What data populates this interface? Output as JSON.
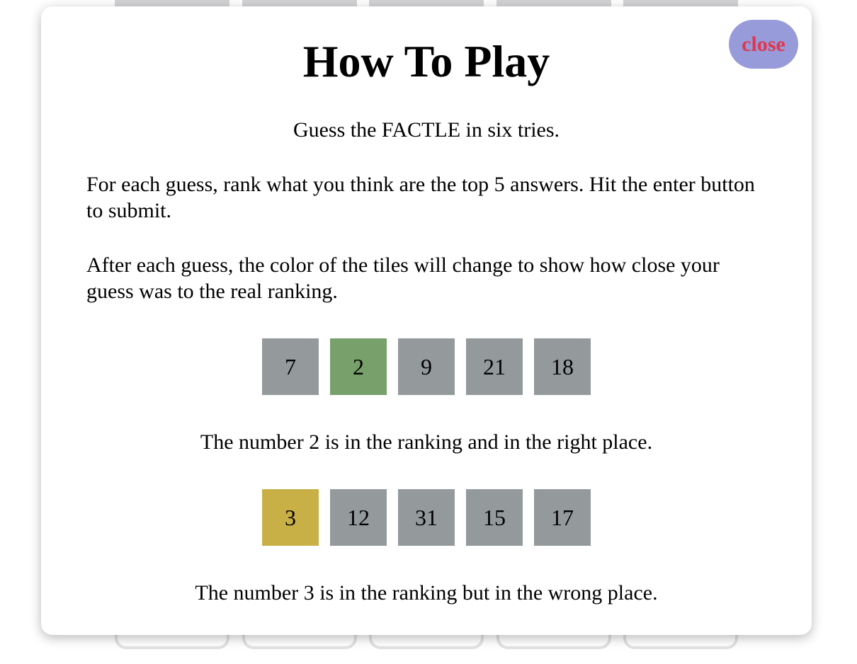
{
  "modal": {
    "title": "How To Play",
    "close_label": "close",
    "intro": "Guess the FACTLE in six tries.",
    "para1": "For each guess, rank what you think are the top 5 answers. Hit the enter button to submit.",
    "para2": "After each guess, the color of the tiles will change to show how close your guess was to the real ranking.",
    "example1": {
      "tiles": [
        {
          "value": "7",
          "state": "absent"
        },
        {
          "value": "2",
          "state": "correct"
        },
        {
          "value": "9",
          "state": "absent"
        },
        {
          "value": "21",
          "state": "absent"
        },
        {
          "value": "18",
          "state": "absent"
        }
      ],
      "caption": "The number 2 is in the ranking and in the right place."
    },
    "example2": {
      "tiles": [
        {
          "value": "3",
          "state": "present"
        },
        {
          "value": "12",
          "state": "absent"
        },
        {
          "value": "31",
          "state": "absent"
        },
        {
          "value": "15",
          "state": "absent"
        },
        {
          "value": "17",
          "state": "absent"
        }
      ],
      "caption": "The number 3 is in the ranking but in the wrong place."
    }
  },
  "colors": {
    "correct": "#77a06a",
    "present": "#c9b046",
    "absent": "#949a9c",
    "close_bg": "#979bd9",
    "close_text": "#e0374f"
  }
}
